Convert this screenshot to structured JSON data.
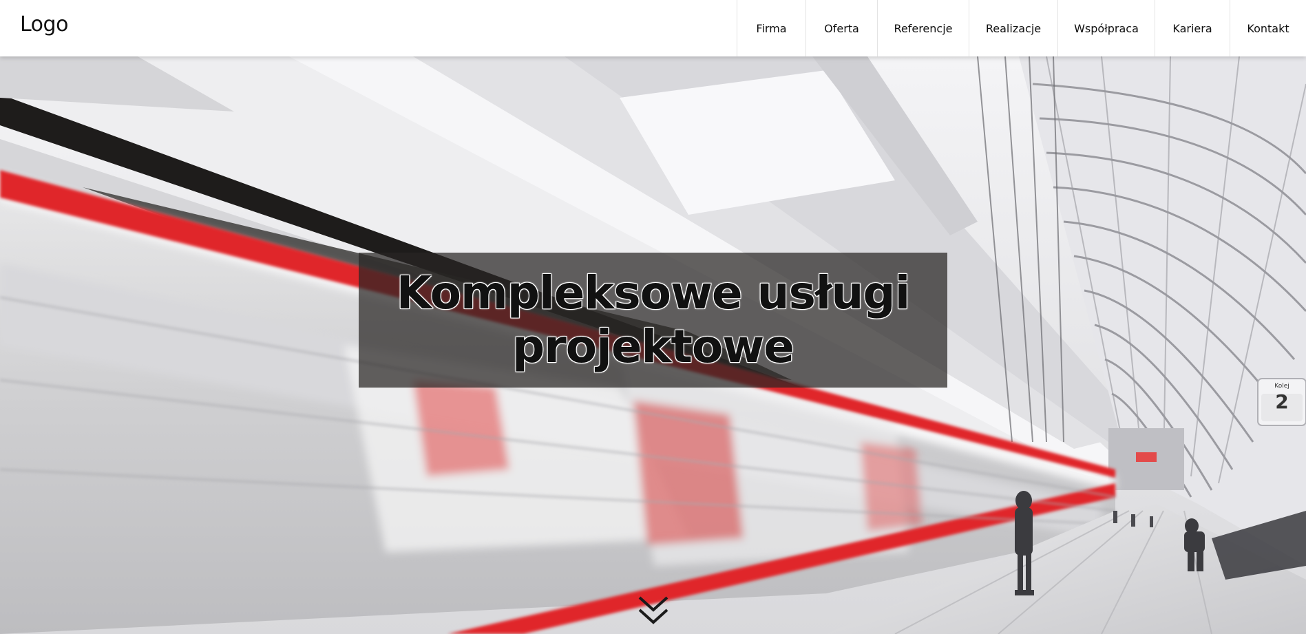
{
  "header": {
    "logo": "Logo",
    "nav": [
      {
        "label": "Firma"
      },
      {
        "label": "Oferta"
      },
      {
        "label": "Referencje"
      },
      {
        "label": "Realizacje"
      },
      {
        "label": "Współpraca"
      },
      {
        "label": "Kariera"
      },
      {
        "label": "Kontakt"
      }
    ]
  },
  "hero": {
    "headline_line1": "Kompleksowe usługi",
    "headline_line2": "projektowe",
    "platform_sign_label": "Kolej",
    "platform_sign_number": "2",
    "scroll_icon": "double-chevron-down-icon"
  },
  "colors": {
    "accent_red": "#e0262a",
    "text_dark": "#111111",
    "headline_box": "rgba(40,38,36,0.72)"
  }
}
